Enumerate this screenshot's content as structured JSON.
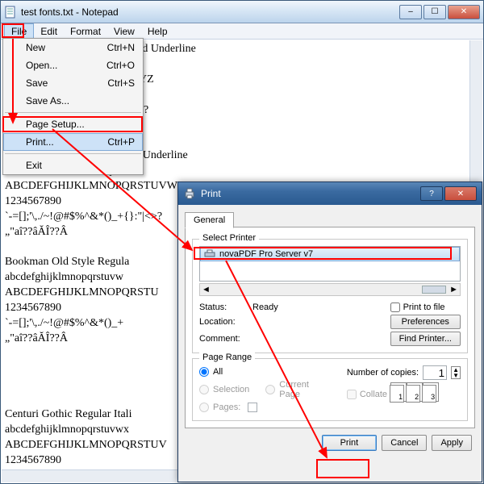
{
  "notepad": {
    "title": "test fonts.txt - Notepad",
    "menubar": [
      "File",
      "Edit",
      "Format",
      "View",
      "Help"
    ],
    "content": "                                   talic Bold Underline\n                                   xyz\n                                   UVWXYZ\n\n                                   +{}:\"|<>?\n\n\n                                   lic Bold Underline\n                                   xyz\nABCDEFGHIJKLMNOPQRSTUVWXYZ\n1234567890\n`-=[];'\\,./~!@#$%^&*()_+{}:\"|<>?\n„\"aî??âĂÎ??Â\n\nBookman Old Style Regula\nabcdefghijklmnopqrstuvw\nABCDEFGHIJKLMNOPQRSTU\n1234567890\n`-=[];'\\,./~!@#$%^&*()_+\n„\"aî??âĂÎ??Â\n\n\n\n\nCenturi Gothic Regular Itali\nabcdefghijklmnopqrstuvwx\nABCDEFGHIJKLMNOPQRSTUV\n1234567890"
  },
  "menu": {
    "items": [
      {
        "label": "New",
        "accel": "Ctrl+N"
      },
      {
        "label": "Open...",
        "accel": "Ctrl+O"
      },
      {
        "label": "Save",
        "accel": "Ctrl+S"
      },
      {
        "label": "Save As...",
        "accel": ""
      }
    ],
    "page_setup": "Page Setup...",
    "print": {
      "label": "Print...",
      "accel": "Ctrl+P"
    },
    "exit": "Exit"
  },
  "print_dialog": {
    "title": "Print",
    "tab": "General",
    "select_printer": "Select Printer",
    "printer": "novaPDF Pro Server v7",
    "status_label": "Status:",
    "status_value": "Ready",
    "location_label": "Location:",
    "comment_label": "Comment:",
    "print_to_file": "Print to file",
    "preferences": "Preferences",
    "find_printer": "Find Printer...",
    "page_range": "Page Range",
    "all": "All",
    "selection": "Selection",
    "current_page": "Current Page",
    "pages": "Pages:",
    "num_copies_label": "Number of copies:",
    "num_copies": "1",
    "collate": "Collate",
    "collate_pages": [
      "1",
      "2",
      "3"
    ],
    "btn_print": "Print",
    "btn_cancel": "Cancel",
    "btn_apply": "Apply"
  }
}
